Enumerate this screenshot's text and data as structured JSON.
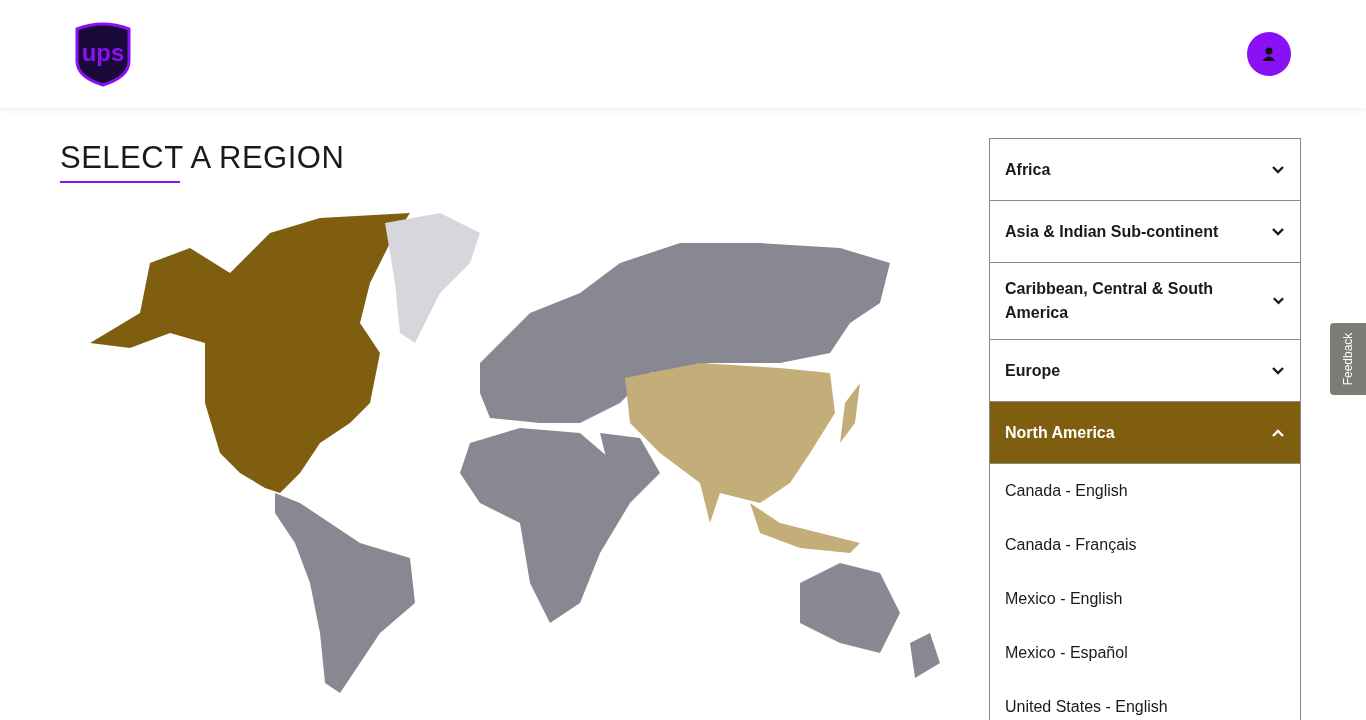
{
  "header": {
    "logo_text": "ups"
  },
  "title": "SELECT A REGION",
  "regions": [
    {
      "label": "Africa",
      "expanded": false
    },
    {
      "label": "Asia & Indian Sub-continent",
      "expanded": false
    },
    {
      "label": "Caribbean, Central & South America",
      "expanded": false
    },
    {
      "label": "Europe",
      "expanded": false
    },
    {
      "label": "North America",
      "expanded": true,
      "countries": [
        "Canada - English",
        "Canada - Français",
        "Mexico - English",
        "Mexico - Español",
        "United States - English"
      ]
    }
  ],
  "feedback": "Feedback"
}
